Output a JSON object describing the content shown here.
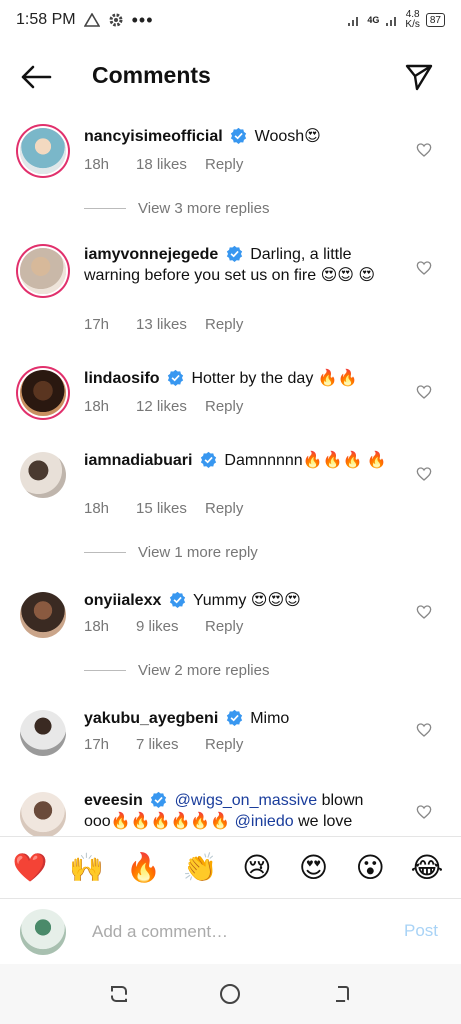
{
  "status_bar": {
    "time": "1:58 PM",
    "network": "4G",
    "speed_value": "4.8",
    "speed_unit": "K/s",
    "battery": "87"
  },
  "header": {
    "title": "Comments"
  },
  "comments": [
    {
      "username": "nancyisimeofficial",
      "verified": true,
      "text": "Woosh😍",
      "time": "18h",
      "likes": "18 likes",
      "reply": "Reply",
      "has_story": true,
      "view_replies": "View 3 more replies"
    },
    {
      "username": "iamyvonnejegede",
      "verified": true,
      "text": "Darling, a little warning before you set us on fire 😍😍 😍",
      "time": "17h",
      "likes": "13 likes",
      "reply": "Reply",
      "has_story": true
    },
    {
      "username": "lindaosifo",
      "verified": true,
      "text": "Hotter by the day 🔥🔥",
      "time": "18h",
      "likes": "12 likes",
      "reply": "Reply",
      "has_story": true
    },
    {
      "username": "iamnadiabuari",
      "verified": true,
      "text": "Damnnnnn🔥🔥🔥 🔥",
      "time": "18h",
      "likes": "15 likes",
      "reply": "Reply",
      "has_story": false,
      "view_replies": "View 1 more reply"
    },
    {
      "username": "onyiialexx",
      "verified": true,
      "text": "Yummy 😍😍😍",
      "time": "18h",
      "likes": "9 likes",
      "reply": "Reply",
      "has_story": false,
      "view_replies": "View 2 more replies"
    },
    {
      "username": "yakubu_ayegbeni",
      "verified": true,
      "text": "Mimo",
      "time": "17h",
      "likes": "7 likes",
      "reply": "Reply",
      "has_story": false
    },
    {
      "username": "eveesin",
      "verified": true,
      "mention1": "@wigs_on_massive",
      "text_mid": " blown ooo🔥🔥🔥🔥🔥🔥 ",
      "mention2": "@iniedo",
      "text_end": " we love",
      "has_story": false
    }
  ],
  "emoji_bar": [
    "❤️",
    "🙌",
    "🔥",
    "👏",
    "😢",
    "😍",
    "😮",
    "😂"
  ],
  "input": {
    "placeholder": "Add a comment…",
    "post_label": "Post"
  },
  "icons": {
    "back": "back-arrow-icon",
    "send": "send-icon",
    "verified": "verified-badge-icon",
    "heart": "heart-outline-icon"
  },
  "colors": {
    "verified_blue": "#3897f0",
    "story_ring": "#e1306c",
    "mention": "#1a3d9c",
    "post_disabled": "#a9d3f6",
    "heart_red": "#e0101d"
  }
}
